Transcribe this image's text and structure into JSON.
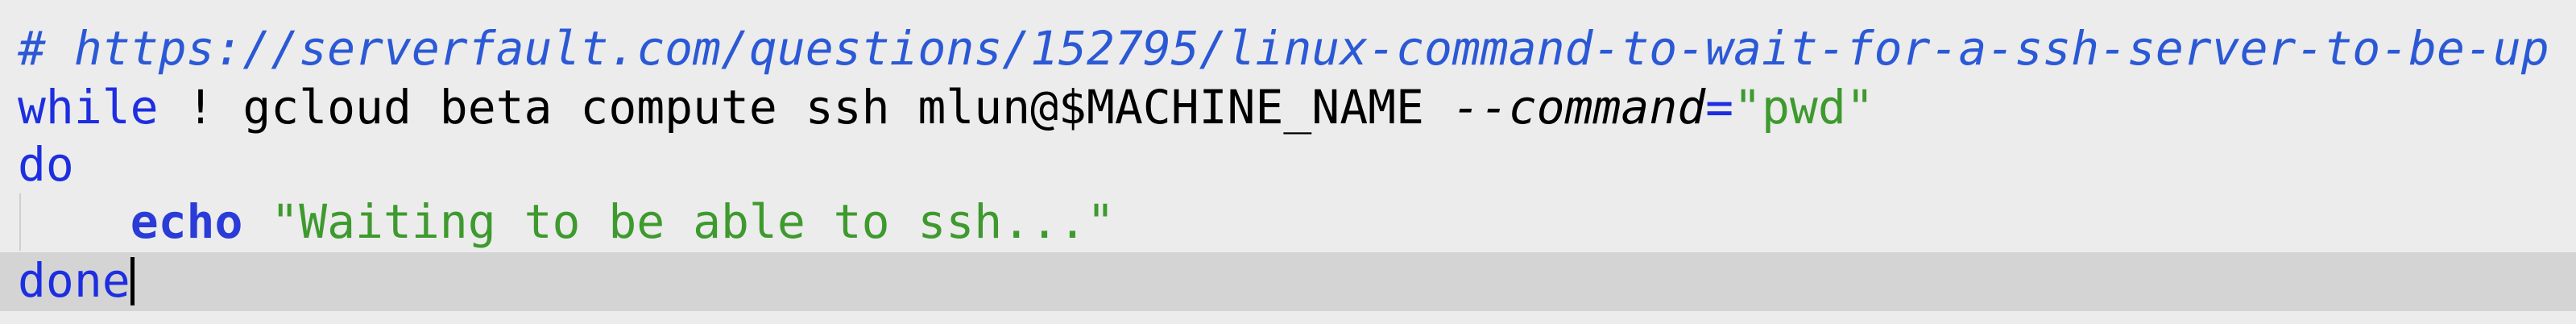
{
  "code": {
    "line1": {
      "comment": "# https://serverfault.com/questions/152795/linux-command-to-wait-for-a-ssh-server-to-be-up"
    },
    "line2": {
      "keyword": "while",
      "command": " ! gcloud beta compute ssh mlun@$MACHINE_NAME ",
      "flag": "--command",
      "equals": "=",
      "value": "\"pwd\""
    },
    "line3": {
      "keyword": "do"
    },
    "line4": {
      "indent": "    ",
      "builtin": "echo",
      "space": " ",
      "string": "\"Waiting to be able to ssh...\""
    },
    "line5": {
      "keyword": "done"
    }
  },
  "colors": {
    "background": "#ececec",
    "current_line": "#d4d4d4",
    "keyword": "#1d2ee0",
    "string": "#3e9a2e",
    "comment": "#2b59d6"
  }
}
